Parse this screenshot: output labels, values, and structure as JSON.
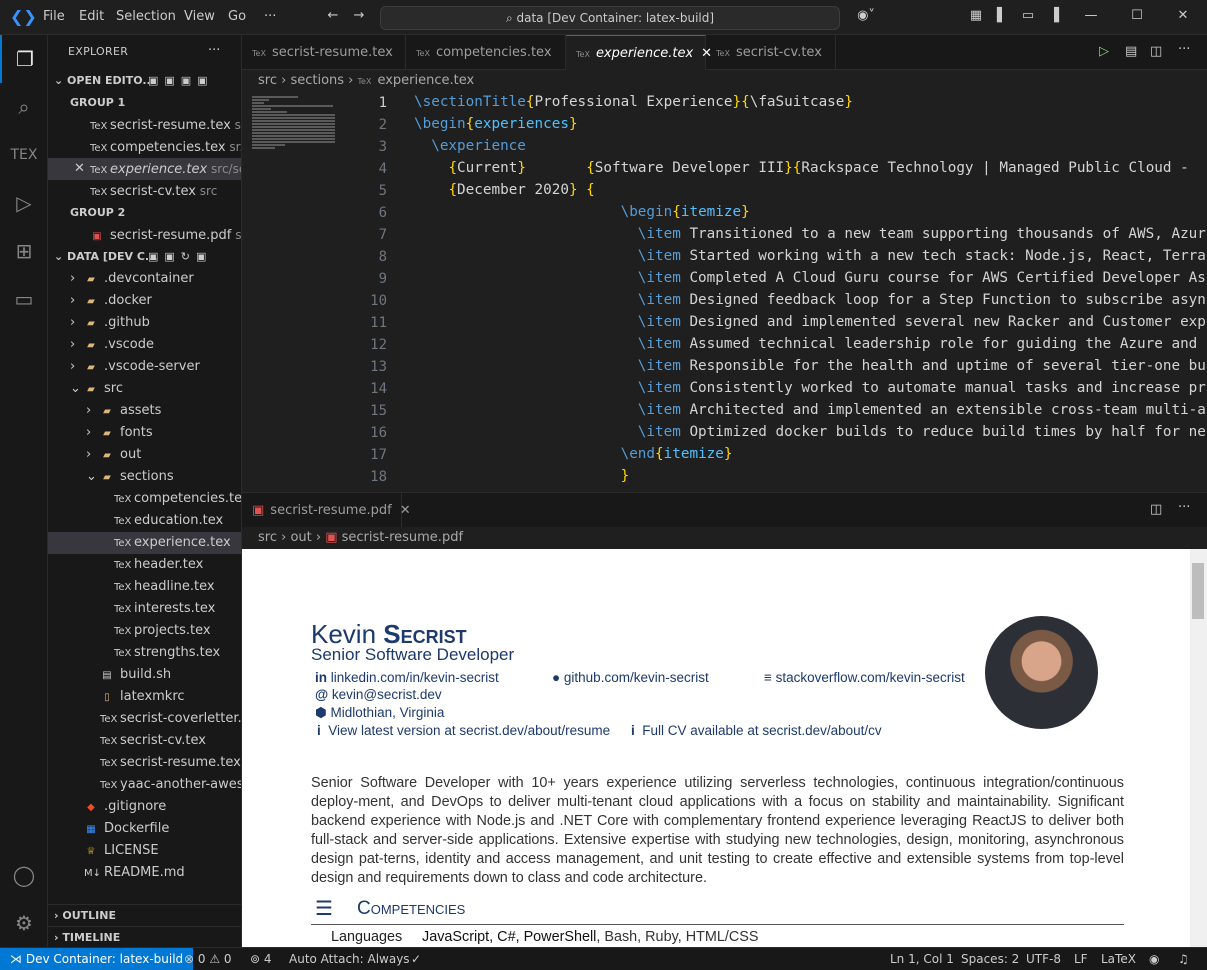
{
  "titlebar": {
    "menus": [
      "File",
      "Edit",
      "Selection",
      "View",
      "Go",
      "···"
    ],
    "command_center": "data [Dev Container: latex-build]"
  },
  "sidebar": {
    "title": "EXPLORER",
    "open_editors_label": "OPEN EDITO...",
    "group1": "GROUP 1",
    "group2": "GROUP 2",
    "open_editors_g1": [
      {
        "name": "secrist-resume.tex",
        "path": "src"
      },
      {
        "name": "competencies.tex",
        "path": "sr..."
      },
      {
        "name": "experience.tex",
        "path": "src/sec..."
      },
      {
        "name": "secrist-cv.tex",
        "path": "src"
      }
    ],
    "open_editors_g2": [
      {
        "name": "secrist-resume.pdf",
        "path": "s..."
      }
    ],
    "folder_label": "DATA [DEV C...",
    "tree": [
      {
        "name": ".devcontainer",
        "indent": 1,
        "arrow": "›"
      },
      {
        "name": ".docker",
        "indent": 1,
        "arrow": "›"
      },
      {
        "name": ".github",
        "indent": 1,
        "arrow": "›"
      },
      {
        "name": ".vscode",
        "indent": 1,
        "arrow": "›"
      },
      {
        "name": ".vscode-server",
        "indent": 1,
        "arrow": "›"
      },
      {
        "name": "src",
        "indent": 1,
        "arrow": "⌄"
      },
      {
        "name": "assets",
        "indent": 2,
        "arrow": "›"
      },
      {
        "name": "fonts",
        "indent": 2,
        "arrow": "›"
      },
      {
        "name": "out",
        "indent": 2,
        "arrow": "›"
      },
      {
        "name": "sections",
        "indent": 2,
        "arrow": "⌄"
      },
      {
        "name": "competencies.tex",
        "indent": 3,
        "arrow": ""
      },
      {
        "name": "education.tex",
        "indent": 3,
        "arrow": ""
      },
      {
        "name": "experience.tex",
        "indent": 3,
        "arrow": ""
      },
      {
        "name": "header.tex",
        "indent": 3,
        "arrow": ""
      },
      {
        "name": "headline.tex",
        "indent": 3,
        "arrow": ""
      },
      {
        "name": "interests.tex",
        "indent": 3,
        "arrow": ""
      },
      {
        "name": "projects.tex",
        "indent": 3,
        "arrow": ""
      },
      {
        "name": "strengths.tex",
        "indent": 3,
        "arrow": ""
      },
      {
        "name": "build.sh",
        "indent": 2,
        "arrow": ""
      },
      {
        "name": "latexmkrc",
        "indent": 2,
        "arrow": ""
      },
      {
        "name": "secrist-coverletter.tex",
        "indent": 2,
        "arrow": ""
      },
      {
        "name": "secrist-cv.tex",
        "indent": 2,
        "arrow": ""
      },
      {
        "name": "secrist-resume.tex",
        "indent": 2,
        "arrow": ""
      },
      {
        "name": "yaac-another-aweso...",
        "indent": 2,
        "arrow": ""
      },
      {
        "name": ".gitignore",
        "indent": 1,
        "arrow": ""
      },
      {
        "name": "Dockerfile",
        "indent": 1,
        "arrow": ""
      },
      {
        "name": "LICENSE",
        "indent": 1,
        "arrow": ""
      },
      {
        "name": "README.md",
        "indent": 1,
        "arrow": ""
      }
    ],
    "outline": "OUTLINE",
    "timeline": "TIMELINE"
  },
  "tabs": [
    {
      "label": "secrist-resume.tex"
    },
    {
      "label": "competencies.tex"
    },
    {
      "label": "experience.tex"
    },
    {
      "label": "secrist-cv.tex"
    }
  ],
  "breadcrumb1": [
    "src",
    "sections",
    "experience.tex"
  ],
  "code": {
    "line_numbers": [
      "1",
      "2",
      "3",
      "4",
      "5",
      "6",
      "7",
      "8",
      "9",
      "10",
      "11",
      "12",
      "13",
      "14",
      "15",
      "16",
      "17",
      "18"
    ],
    "lines": [
      [
        [
          "kw",
          "\\sectionTitle"
        ],
        [
          "br",
          "{"
        ],
        [
          "tx",
          "Professional Experience"
        ],
        [
          "br",
          "}{"
        ],
        [
          "tx",
          "\\faSuitcase"
        ],
        [
          "br",
          "}"
        ]
      ],
      [
        [
          "kw",
          "\\begin"
        ],
        [
          "br",
          "{"
        ],
        [
          "arg",
          "experiences"
        ],
        [
          "br",
          "}"
        ]
      ],
      [
        [
          "tx",
          "  "
        ],
        [
          "kw",
          "\\experience"
        ]
      ],
      [
        [
          "tx",
          "    "
        ],
        [
          "br",
          "{"
        ],
        [
          "tx",
          "Current"
        ],
        [
          "br",
          "}"
        ],
        [
          "tx",
          "       "
        ],
        [
          "br",
          "{"
        ],
        [
          "tx",
          "Software Developer III"
        ],
        [
          "br",
          "}{"
        ],
        [
          "tx",
          "Rackspace Technology | Managed Public Cloud -"
        ]
      ],
      [
        [
          "tx",
          "    "
        ],
        [
          "br",
          "{"
        ],
        [
          "tx",
          "December 2020"
        ],
        [
          "br",
          "}"
        ],
        [
          "tx",
          " "
        ],
        [
          "br",
          "{"
        ]
      ],
      [
        [
          "tx",
          "                        "
        ],
        [
          "kw",
          "\\begin"
        ],
        [
          "br",
          "{"
        ],
        [
          "arg",
          "itemize"
        ],
        [
          "br",
          "}"
        ]
      ],
      [
        [
          "tx",
          "                          "
        ],
        [
          "kw",
          "\\item"
        ],
        [
          "tx",
          " Transitioned to a new team supporting thousands of AWS, Azur"
        ]
      ],
      [
        [
          "tx",
          "                          "
        ],
        [
          "kw",
          "\\item"
        ],
        [
          "tx",
          " Started working with a new tech stack: Node.js, React, Terra"
        ]
      ],
      [
        [
          "tx",
          "                          "
        ],
        [
          "kw",
          "\\item"
        ],
        [
          "tx",
          " Completed A Cloud Guru course for AWS Certified Developer As"
        ]
      ],
      [
        [
          "tx",
          "                          "
        ],
        [
          "kw",
          "\\item"
        ],
        [
          "tx",
          " Designed feedback loop for a Step Function to subscribe asyn"
        ]
      ],
      [
        [
          "tx",
          "                          "
        ],
        [
          "kw",
          "\\item"
        ],
        [
          "tx",
          " Designed and implemented several new Racker and Customer exp"
        ]
      ],
      [
        [
          "tx",
          "                          "
        ],
        [
          "kw",
          "\\item"
        ],
        [
          "tx",
          " Assumed technical leadership role for guiding the Azure and "
        ]
      ],
      [
        [
          "tx",
          "                          "
        ],
        [
          "kw",
          "\\item"
        ],
        [
          "tx",
          " Responsible for the health and uptime of several tier-one bu"
        ]
      ],
      [
        [
          "tx",
          "                          "
        ],
        [
          "kw",
          "\\item"
        ],
        [
          "tx",
          " Consistently worked to automate manual tasks and increase pr"
        ]
      ],
      [
        [
          "tx",
          "                          "
        ],
        [
          "kw",
          "\\item"
        ],
        [
          "tx",
          " Architected and implemented an extensible cross-team multi-a"
        ]
      ],
      [
        [
          "tx",
          "                          "
        ],
        [
          "kw",
          "\\item"
        ],
        [
          "tx",
          " Optimized docker builds to reduce build times by half for ne"
        ]
      ],
      [
        [
          "tx",
          "                        "
        ],
        [
          "kw",
          "\\end"
        ],
        [
          "br",
          "{"
        ],
        [
          "arg",
          "itemize"
        ],
        [
          "br",
          "}"
        ]
      ],
      [
        [
          "tx",
          "                        "
        ],
        [
          "br",
          "}"
        ]
      ]
    ]
  },
  "pdf_tab": "secrist-resume.pdf",
  "breadcrumb2": [
    "src",
    "out",
    "secrist-resume.pdf"
  ],
  "pdf": {
    "first_name": "Kevin ",
    "last_name": "Secrist",
    "role": "Senior Software Developer",
    "linkedin": "linkedin.com/in/kevin-secrist",
    "github": "github.com/kevin-secrist",
    "stackoverflow": "stackoverflow.com/kevin-secrist",
    "email": "kevin@secrist.dev",
    "location": "Midlothian, Virginia",
    "latest": "View latest version at secrist.dev/about/resume",
    "cv": "Full CV available at secrist.dev/about/cv",
    "summary": "Senior Software Developer with 10+ years experience utilizing serverless technologies, continuous integration/continuous deploy-ment, and DevOps to deliver multi-tenant cloud applications with a focus on stability and maintainability.  Significant backend experience with Node.js and .NET Core with complementary frontend experience leveraging ReactJS to deliver both full-stack and server-side applications. Extensive expertise with studying new technologies, design, monitoring, asynchronous design pat-terns, identity and access management, and unit testing to create effective and extensible systems from top-level design and requirements down to class and code architecture.",
    "competencies_title": "Competencies",
    "languages_label": "Languages",
    "languages_bold": "JavaScript, C#, PowerShell",
    "languages_rest": ", Bash, Ruby, HTML/CSS"
  },
  "status": {
    "remote": "Dev Container: latex-build",
    "problems": "⊗ 0 ⚠ 0",
    "ports": "4",
    "auto_attach": "Auto Attach: Always",
    "position": "Ln 1, Col 1",
    "spaces": "Spaces: 2",
    "encoding": "UTF-8",
    "eol": "LF",
    "language": "LaTeX"
  }
}
